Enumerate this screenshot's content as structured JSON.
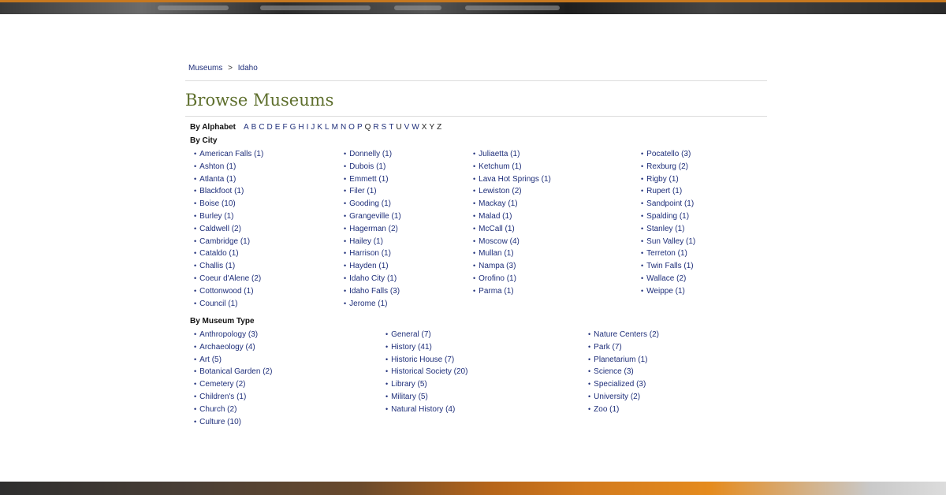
{
  "breadcrumb": {
    "root": "Museums",
    "separator": ">",
    "current": "Idaho"
  },
  "page_title": "Browse Museums",
  "alphabet": {
    "label": "By Alphabet",
    "letters": [
      "A",
      "B",
      "C",
      "D",
      "E",
      "F",
      "G",
      "H",
      "I",
      "J",
      "K",
      "L",
      "M",
      "N",
      "O",
      "P",
      "Q",
      "R",
      "S",
      "T",
      "U",
      "V",
      "W",
      "X",
      "Y",
      "Z"
    ]
  },
  "city": {
    "label": "By City",
    "columns": [
      [
        "American Falls (1)",
        "Ashton (1)",
        "Atlanta (1)",
        "Blackfoot (1)",
        "Boise (10)",
        "Burley (1)",
        "Caldwell (2)",
        "Cambridge (1)",
        "Cataldo (1)",
        "Challis (1)",
        "Coeur d'Alene (2)",
        "Cottonwood (1)",
        "Council (1)"
      ],
      [
        "Donnelly (1)",
        "Dubois (1)",
        "Emmett (1)",
        "Filer (1)",
        "Gooding (1)",
        "Grangeville (1)",
        "Hagerman (2)",
        "Hailey (1)",
        "Harrison (1)",
        "Hayden (1)",
        "Idaho City (1)",
        "Idaho Falls (3)",
        "Jerome (1)"
      ],
      [
        "Juliaetta (1)",
        "Ketchum (1)",
        "Lava Hot Springs (1)",
        "Lewiston (2)",
        "Mackay (1)",
        "Malad (1)",
        "McCall (1)",
        "Moscow (4)",
        "Mullan (1)",
        "Nampa (3)",
        "Orofino (1)",
        "Parma (1)"
      ],
      [
        "Pocatello (3)",
        "Rexburg (2)",
        "Rigby (1)",
        "Rupert (1)",
        "Sandpoint (1)",
        "Spalding (1)",
        "Stanley (1)",
        "Sun Valley (1)",
        "Terreton (1)",
        "Twin Falls (1)",
        "Wallace (2)",
        "Weippe (1)"
      ]
    ]
  },
  "museum_type": {
    "label": "By Museum Type",
    "columns": [
      [
        "Anthropology (3)",
        "Archaeology (4)",
        "Art (5)",
        "Botanical Garden (2)",
        "Cemetery (2)",
        "Children's (1)",
        "Church (2)",
        "Culture (10)"
      ],
      [
        "General (7)",
        "History (41)",
        "Historic House (7)",
        "Historical Society (20)",
        "Library (5)",
        "Military (5)",
        "Natural History (4)"
      ],
      [
        "Nature Centers (2)",
        "Park (7)",
        "Planetarium (1)",
        "Science (3)",
        "Specialized (3)",
        "University (2)",
        "Zoo (1)"
      ]
    ]
  },
  "colors": {
    "link": "#1f2f7a",
    "title": "#5e6f2d",
    "rule": "#dcdcdc"
  }
}
